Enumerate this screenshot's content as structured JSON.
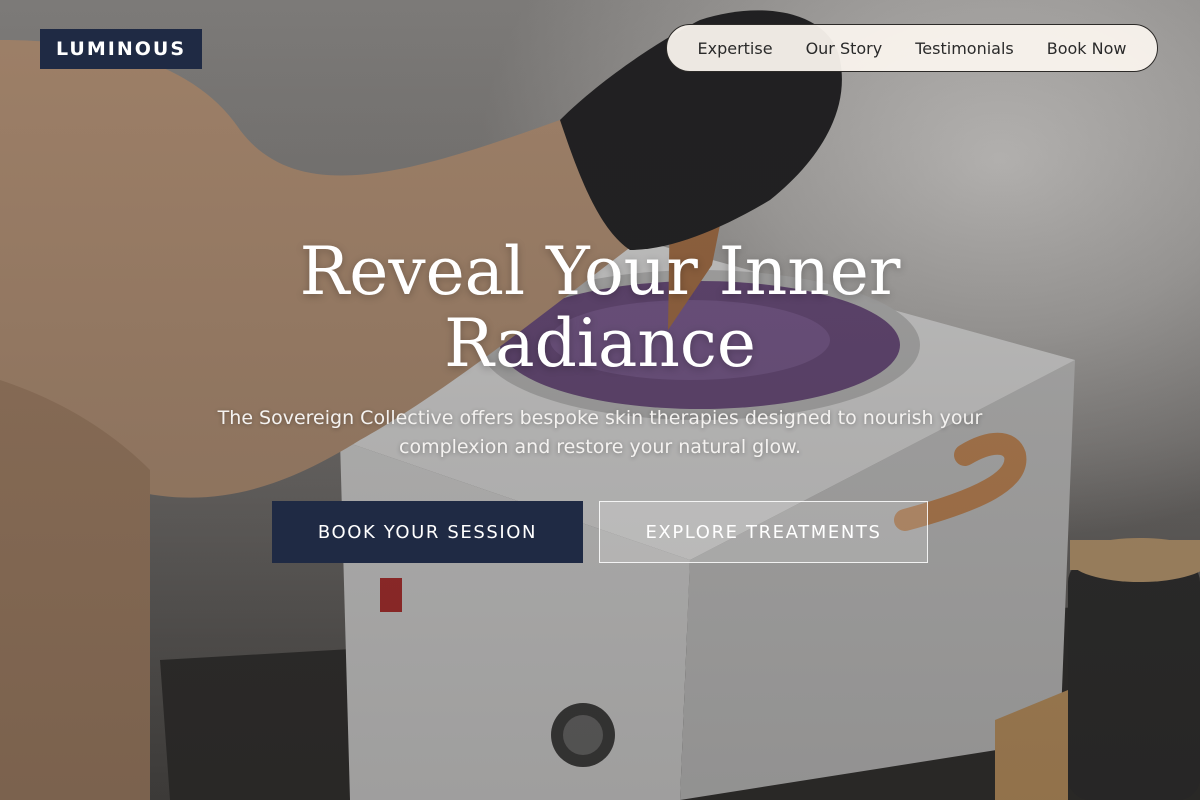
{
  "brand": {
    "logo_text": "LUMINOUS"
  },
  "nav": {
    "items": [
      {
        "label": "Expertise"
      },
      {
        "label": "Our Story"
      },
      {
        "label": "Testimonials"
      },
      {
        "label": "Book Now"
      }
    ]
  },
  "hero": {
    "headline_line1": "Reveal Your Inner",
    "headline_line2": "Radiance",
    "subtext_line1": "The Sovereign Collective offers bespoke skin therapies designed to nourish your",
    "subtext_line2": "complexion and restore your natural glow.",
    "primary_cta": "BOOK YOUR SESSION",
    "secondary_cta": "EXPLORE TREATMENTS",
    "background_image": "wax-warmer-photo"
  },
  "colors": {
    "brand_navy": "#1f2a44",
    "nav_background": "#faf4ee",
    "headline_text": "#ffffff"
  }
}
